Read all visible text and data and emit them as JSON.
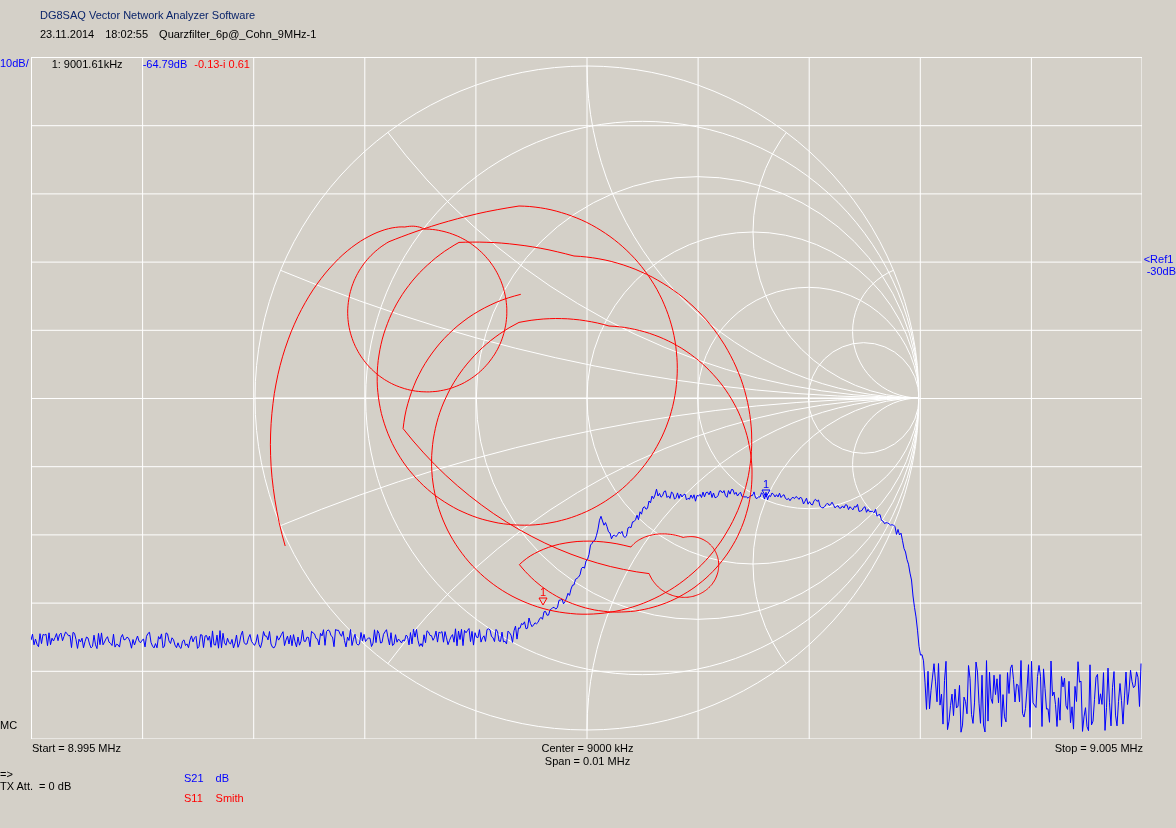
{
  "window": {
    "title": "DG8SAQ Vector Network Analyzer Software"
  },
  "info": {
    "date": "23.11.2014",
    "time": "18:02:55",
    "file": "Quarzfilter_6p@_Cohn_9MHz-1"
  },
  "plot": {
    "scale": "10dB/",
    "mode": "MC",
    "readout": {
      "marker": "1: 9001.61kHz",
      "s21": "-64.79dB",
      "s11": "-0.13-i 0.61"
    },
    "ref": {
      "label": "<Ref1",
      "value": "-30dB"
    }
  },
  "traces": [
    {
      "kind": "dB",
      "name": "S21",
      "format": "dB",
      "color": "#0000ff",
      "marker": "1"
    },
    {
      "kind": "smith",
      "name": "S11",
      "format": "Smith",
      "color": "#ff0000",
      "marker": "1"
    }
  ],
  "sweep": {
    "start": "Start = 8.995 MHz",
    "center": "Center = 9000 kHz",
    "span": "Span = 0.01 MHz",
    "stop": "Stop = 9.005 MHz"
  },
  "status": {
    "arrow": "=>",
    "tx_att": "TX Att.  = 0 dB"
  }
}
